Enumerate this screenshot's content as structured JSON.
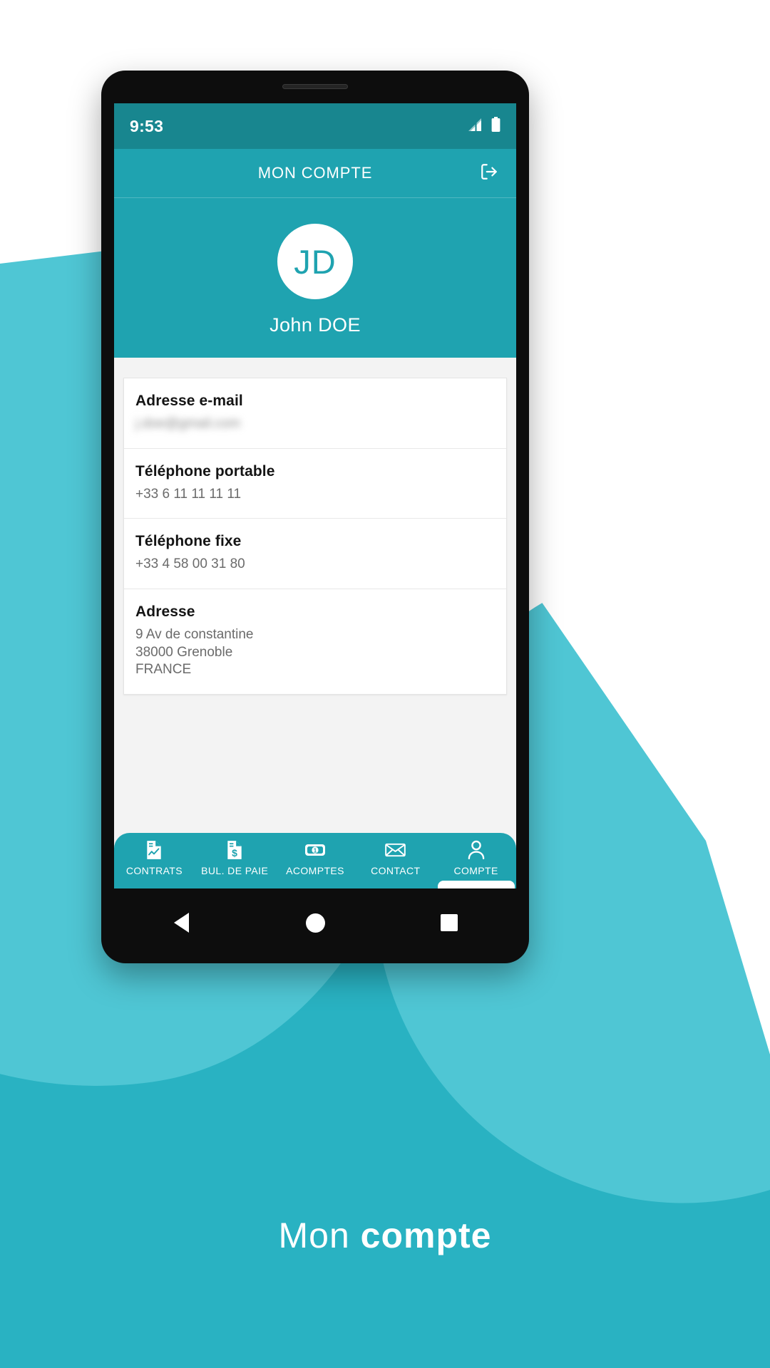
{
  "colors": {
    "brand_teal": "#1FA3B0",
    "status_bar_teal": "#18868F",
    "bg_teal": "#29B2C2",
    "bg_teal_light": "#4FC6D4",
    "content_bg": "#f3f3f3",
    "card_bg": "#ffffff",
    "label_text": "#141414",
    "value_text": "#6b6b6b"
  },
  "status_bar": {
    "time": "9:53",
    "signal_icon": "signal-bars-icon",
    "battery_icon": "battery-full-icon"
  },
  "app_bar": {
    "title": "MON COMPTE",
    "logout_icon": "logout-icon"
  },
  "profile": {
    "avatar_initials": "JD",
    "avatar_icon": "avatar",
    "name": "John DOE"
  },
  "info_rows": [
    {
      "label": "Adresse e-mail",
      "value": "j.doe@gmail.com",
      "redacted": true,
      "lines": []
    },
    {
      "label": "Téléphone portable",
      "value": "+33 6 11 11 11 11",
      "redacted": false,
      "lines": []
    },
    {
      "label": "Téléphone fixe",
      "value": "+33 4 58 00 31 80",
      "redacted": false,
      "lines": []
    },
    {
      "label": "Adresse",
      "value": "",
      "redacted": false,
      "lines": [
        "9 Av de constantine",
        "38000 Grenoble",
        "FRANCE"
      ]
    }
  ],
  "bottom_nav": {
    "items": [
      {
        "label": "CONTRATS",
        "icon": "document-chart-icon",
        "active": false
      },
      {
        "label": "BUL. DE PAIE",
        "icon": "document-dollar-icon",
        "active": false
      },
      {
        "label": "ACOMPTES",
        "icon": "banknote-icon",
        "active": false
      },
      {
        "label": "CONTACT",
        "icon": "envelope-icon",
        "active": false
      },
      {
        "label": "COMPTE",
        "icon": "person-icon",
        "active": true
      }
    ]
  },
  "system_nav": {
    "back_icon": "back-triangle-icon",
    "home_icon": "home-circle-icon",
    "recents_icon": "recents-square-icon"
  },
  "caption": {
    "light": "Mon",
    "bold": "compte"
  }
}
